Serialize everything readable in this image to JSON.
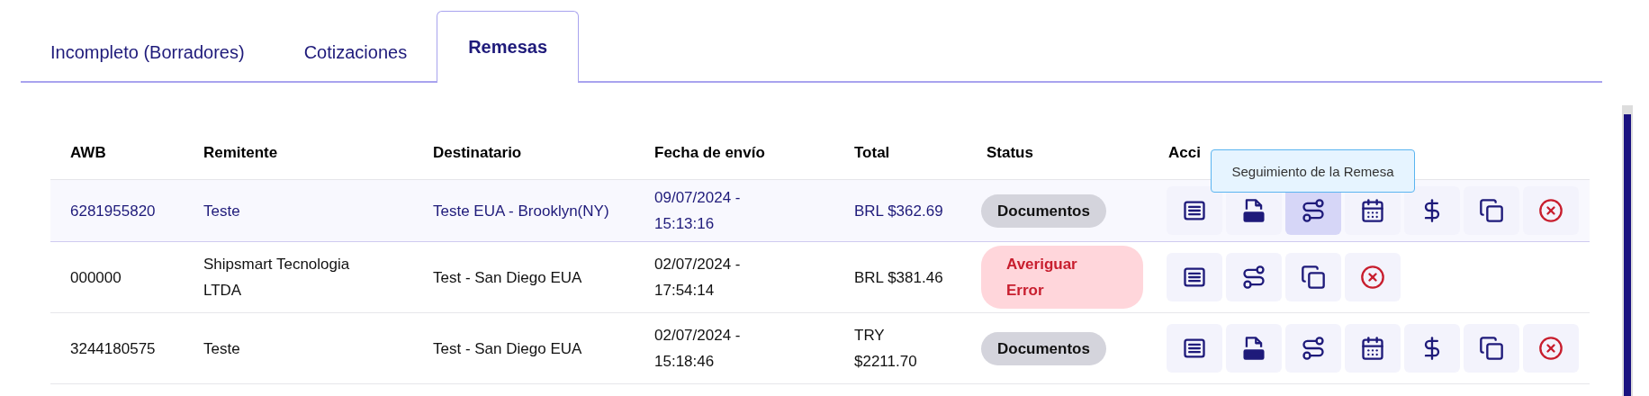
{
  "tabs": [
    {
      "label": "Incompleto (Borradores)",
      "selected": false
    },
    {
      "label": "Cotizaciones",
      "selected": false
    },
    {
      "label": "Remesas",
      "selected": true
    }
  ],
  "table": {
    "columns": [
      "AWB",
      "Remitente",
      "Destinatario",
      "Fecha de envío",
      "Total",
      "Status",
      "Acci"
    ],
    "tooltip": "Seguimiento de la Remesa",
    "rows": [
      {
        "selected": true,
        "awb": "6281955820",
        "sender": "Teste",
        "recipient": "Teste EUA - Brooklyn(NY)",
        "date": "09/07/2024 - 15:13:16",
        "total": "BRL $362.69",
        "status": {
          "kind": "neutral",
          "label": "Documentos"
        },
        "actions": [
          {
            "kind": "details",
            "selected": false
          },
          {
            "kind": "pdf",
            "selected": false
          },
          {
            "kind": "tracking",
            "selected": true
          },
          {
            "kind": "schedule",
            "selected": false
          },
          {
            "kind": "payment",
            "selected": false
          },
          {
            "kind": "duplicate",
            "selected": false
          },
          {
            "kind": "cancel",
            "selected": false
          }
        ]
      },
      {
        "selected": false,
        "awb": "000000",
        "sender": "Shipsmart Tecnologia LTDA",
        "recipient": "Test - San Diego EUA",
        "date": "02/07/2024 - 17:54:14",
        "total": "BRL $381.46",
        "status": {
          "kind": "error",
          "label": "Averiguar Error"
        },
        "actions": [
          {
            "kind": "details",
            "selected": false
          },
          {
            "kind": "tracking",
            "selected": false
          },
          {
            "kind": "duplicate",
            "selected": false
          },
          {
            "kind": "cancel",
            "selected": false
          }
        ]
      },
      {
        "selected": false,
        "awb": "3244180575",
        "sender": "Teste",
        "recipient": "Test - San Diego EUA",
        "date": "02/07/2024 - 15:18:46",
        "total": "TRY $2211.70",
        "status": {
          "kind": "neutral",
          "label": "Documentos"
        },
        "actions": [
          {
            "kind": "details",
            "selected": false
          },
          {
            "kind": "pdf",
            "selected": false
          },
          {
            "kind": "tracking",
            "selected": false
          },
          {
            "kind": "schedule",
            "selected": false
          },
          {
            "kind": "payment",
            "selected": false
          },
          {
            "kind": "duplicate",
            "selected": false
          },
          {
            "kind": "cancel",
            "selected": false
          }
        ]
      }
    ]
  }
}
